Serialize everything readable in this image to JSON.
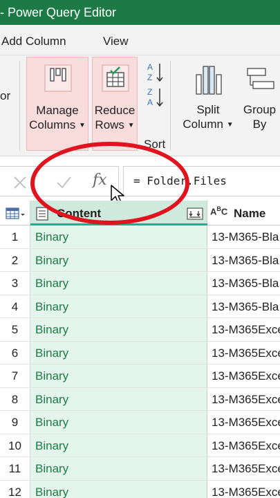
{
  "window": {
    "title": "- Power Query Editor"
  },
  "menu": {
    "items": [
      {
        "label": "Add Column"
      },
      {
        "label": "View"
      }
    ]
  },
  "ribbon": {
    "partial_label": "or",
    "manage_columns": {
      "line1": "Manage",
      "line2": "Columns"
    },
    "reduce_rows": {
      "line1": "Reduce",
      "line2": "Rows"
    },
    "sort_group": {
      "label": "Sort",
      "asc_icon": "sort-ascending-icon",
      "desc_icon": "sort-descending-icon"
    },
    "split_column": {
      "line1": "Split",
      "line2": "Column"
    },
    "group_by": {
      "line1": "Group",
      "line2": "By"
    }
  },
  "formula_bar": {
    "cancel_icon": "close-icon",
    "confirm_icon": "check-icon",
    "fx_label": "fx",
    "formula": "= Folder.Files"
  },
  "grid": {
    "columns": [
      {
        "label": "Content",
        "type_icon": "binary-type-icon"
      },
      {
        "label": "Name",
        "type_icon": "text-type-icon",
        "type_label": "ABC"
      }
    ],
    "rows": [
      {
        "num": "1",
        "content": "Binary",
        "name": "13-M365-Bla"
      },
      {
        "num": "2",
        "content": "Binary",
        "name": "13-M365-Bla"
      },
      {
        "num": "3",
        "content": "Binary",
        "name": "13-M365-Bla"
      },
      {
        "num": "4",
        "content": "Binary",
        "name": "13-M365-Bla"
      },
      {
        "num": "5",
        "content": "Binary",
        "name": "13-M365Exce"
      },
      {
        "num": "6",
        "content": "Binary",
        "name": "13-M365Exce"
      },
      {
        "num": "7",
        "content": "Binary",
        "name": "13-M365Exce"
      },
      {
        "num": "8",
        "content": "Binary",
        "name": "13-M365Exce"
      },
      {
        "num": "9",
        "content": "Binary",
        "name": "13-M365Exce"
      },
      {
        "num": "10",
        "content": "Binary",
        "name": "13-M365Exce"
      },
      {
        "num": "11",
        "content": "Binary",
        "name": "13-M365Exce"
      },
      {
        "num": "12",
        "content": "Binary",
        "name": "13-M365Exce"
      }
    ]
  },
  "colors": {
    "title_bar": "#1d7a45",
    "accent_teal": "#14b38a",
    "selected_ribbon": "#f9dcdc",
    "annotation": "#e0141e"
  }
}
